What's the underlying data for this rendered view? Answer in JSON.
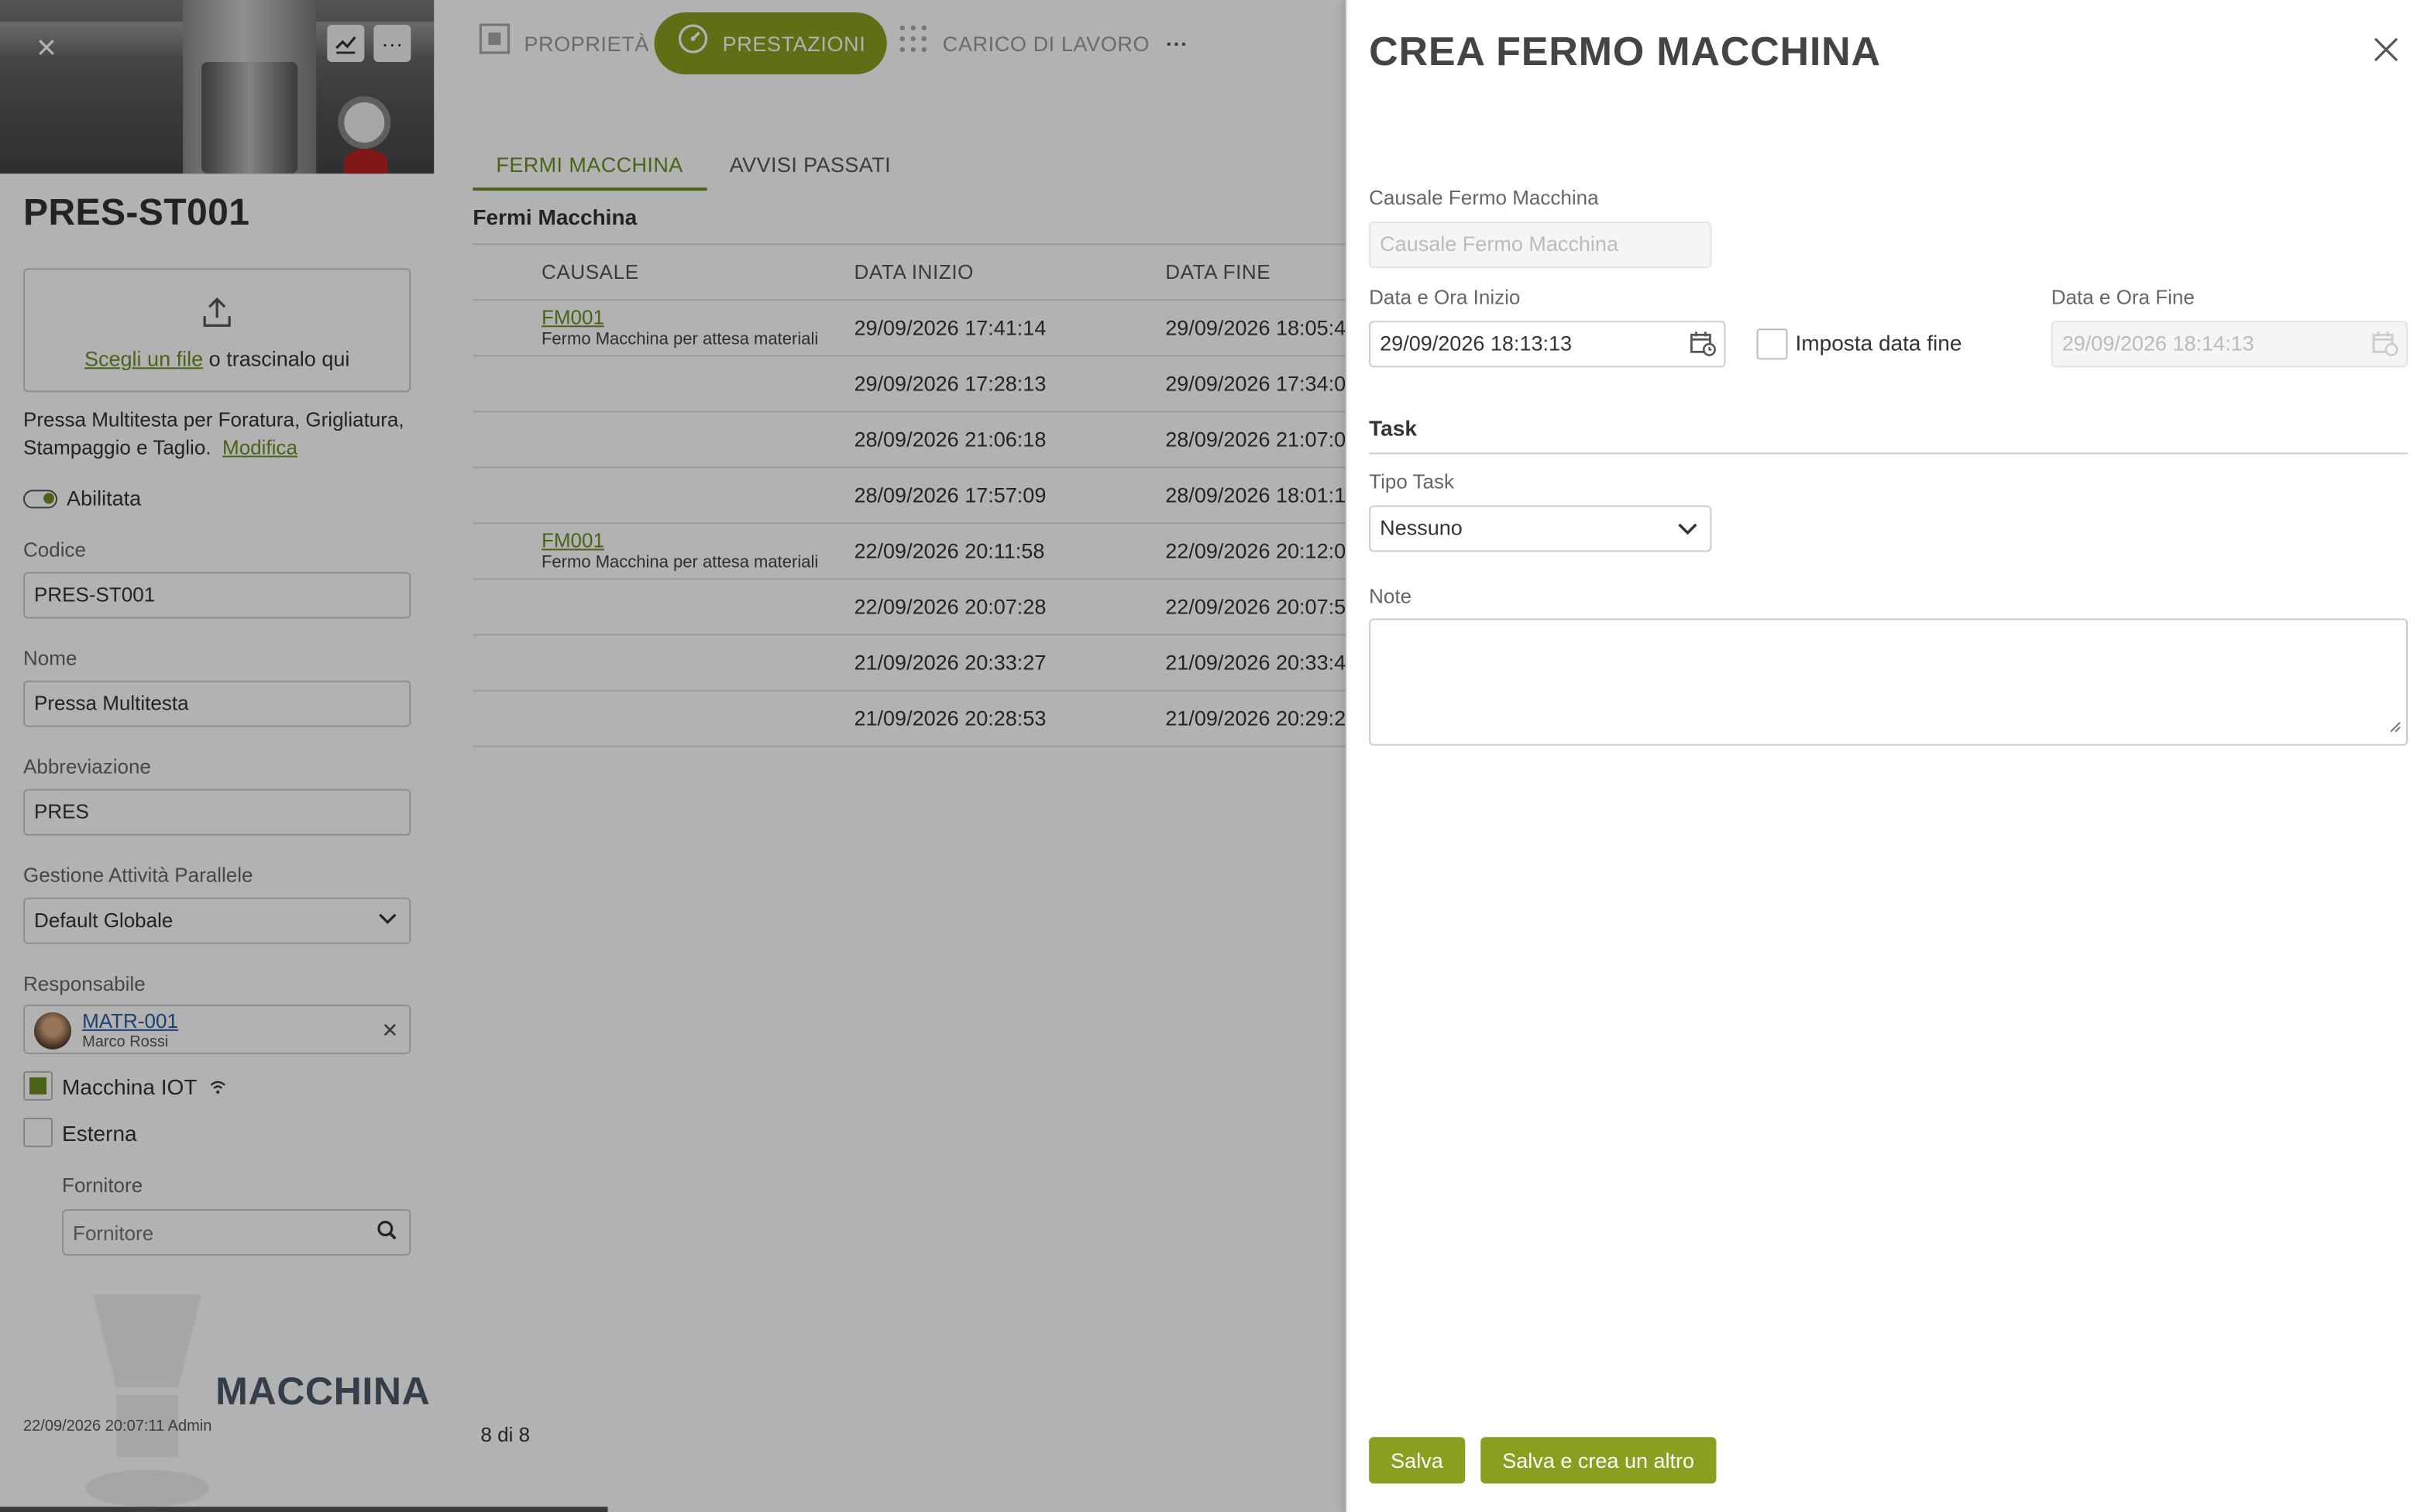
{
  "colors": {
    "accent": "#8a9e1f",
    "accent_text": "#6b8e23",
    "overlay": "rgba(0,0,0,0.30)"
  },
  "machine": {
    "title": "PRES-ST001",
    "upload": {
      "link": "Scegli un file",
      "rest": "o trascinalo qui"
    },
    "description": "Pressa Multitesta per Foratura, Grigliatura, Stampaggio e Taglio.",
    "edit_link": "Modifica",
    "enabled_label": "Abilitata",
    "fields": {
      "codice": {
        "label": "Codice",
        "value": "PRES-ST001"
      },
      "nome": {
        "label": "Nome",
        "value": "Pressa Multitesta"
      },
      "abbreviazione": {
        "label": "Abbreviazione",
        "value": "PRES"
      },
      "gestione": {
        "label": "Gestione Attività Parallele",
        "value": "Default Globale"
      },
      "responsabile": {
        "label": "Responsabile",
        "code": "MATR-001",
        "name": "Marco Rossi"
      }
    },
    "iot_label": "Macchina IOT",
    "external_label": "Esterna",
    "supplier": {
      "label": "Fornitore",
      "placeholder": "Fornitore"
    },
    "type_label": "MACCHINA",
    "audit": "22/09/2026 20:07:11 Admin"
  },
  "nav": {
    "items": [
      {
        "label": "PROPRIETÀ",
        "icon": "frame-icon"
      },
      {
        "label": "PRESTAZIONI",
        "icon": "gauge-icon"
      },
      {
        "label": "CARICO DI LAVORO",
        "icon": "grid-dots-icon"
      }
    ],
    "more": "···"
  },
  "subtabs": [
    "FERMI MACCHINA",
    "AVVISI PASSATI"
  ],
  "table": {
    "title": "Fermi Macchina",
    "columns": [
      "CAUSALE",
      "DATA INIZIO",
      "DATA FINE"
    ],
    "rows": [
      {
        "code": "FM001",
        "desc": "Fermo Macchina per attesa materiali",
        "start": "29/09/2026 17:41:14",
        "end": "29/09/2026 18:05:4"
      },
      {
        "code": "",
        "desc": "",
        "start": "29/09/2026 17:28:13",
        "end": "29/09/2026 17:34:0"
      },
      {
        "code": "",
        "desc": "",
        "start": "28/09/2026 21:06:18",
        "end": "28/09/2026 21:07:0"
      },
      {
        "code": "",
        "desc": "",
        "start": "28/09/2026 17:57:09",
        "end": "28/09/2026 18:01:1"
      },
      {
        "code": "FM001",
        "desc": "Fermo Macchina per attesa materiali",
        "start": "22/09/2026 20:11:58",
        "end": "22/09/2026 20:12:0"
      },
      {
        "code": "",
        "desc": "",
        "start": "22/09/2026 20:07:28",
        "end": "22/09/2026 20:07:5"
      },
      {
        "code": "",
        "desc": "",
        "start": "21/09/2026 20:33:27",
        "end": "21/09/2026 20:33:4"
      },
      {
        "code": "",
        "desc": "",
        "start": "21/09/2026 20:28:53",
        "end": "21/09/2026 20:29:2"
      }
    ],
    "pager": "8 di 8"
  },
  "modal": {
    "title": "CREA FERMO MACCHINA",
    "cause": {
      "label": "Causale Fermo Macchina",
      "placeholder": "Causale Fermo Macchina"
    },
    "start": {
      "label": "Data e Ora Inizio",
      "value": "29/09/2026 18:13:13"
    },
    "set_end_label": "Imposta data fine",
    "end": {
      "label": "Data e Ora Fine",
      "value": "29/09/2026 18:14:13"
    },
    "task_section": "Task",
    "task_type": {
      "label": "Tipo Task",
      "value": "Nessuno"
    },
    "note_label": "Note",
    "save": "Salva",
    "save_new": "Salva e crea un altro"
  }
}
